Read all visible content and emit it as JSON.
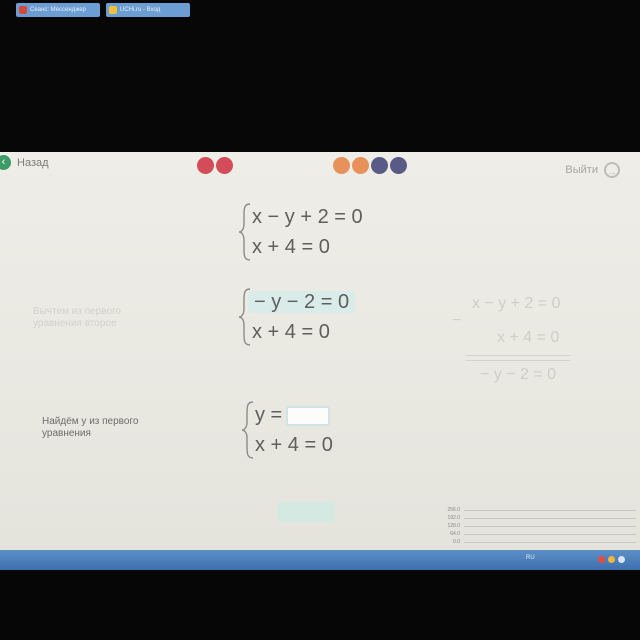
{
  "header": {
    "back_label": "Назад",
    "exit_label": "Выйти",
    "progress_dots_left": [
      "#d24d59",
      "#d24d59"
    ],
    "progress_dots_right": [
      "#e8915a",
      "#e8915a",
      "#5a5a86",
      "#5a5a86"
    ]
  },
  "system1": {
    "eq1": "x − y + 2 = 0",
    "eq2": "x + 4 = 0"
  },
  "step1": {
    "hint": [
      "Вычтем из первого",
      "уравнения второе"
    ],
    "eq1": "− y − 2 = 0",
    "eq2": "x + 4 = 0"
  },
  "subtraction": {
    "minus": "−",
    "row1": "x − y + 2 = 0",
    "row2": "x + 4 = 0",
    "result": "− y − 2 = 0"
  },
  "step2": {
    "hint": [
      "Найдём y из первого",
      "уравнения"
    ],
    "eq1_prefix": "y =",
    "eq1_value": "",
    "eq2": "x + 4 = 0"
  },
  "graph_labels": [
    "256.0",
    "192.0",
    "128.0",
    "64.0",
    "0.0"
  ],
  "taskbar": {
    "tasks": [
      "Сеанс: Мессенджер",
      "UCHi.ru - Вход"
    ],
    "language": "RU"
  },
  "colors": {
    "back_button": "#3f9a6a",
    "highlight": "#d9ecea",
    "input_border": "#cfe4e6",
    "taskbar": "#4a7cb9"
  }
}
